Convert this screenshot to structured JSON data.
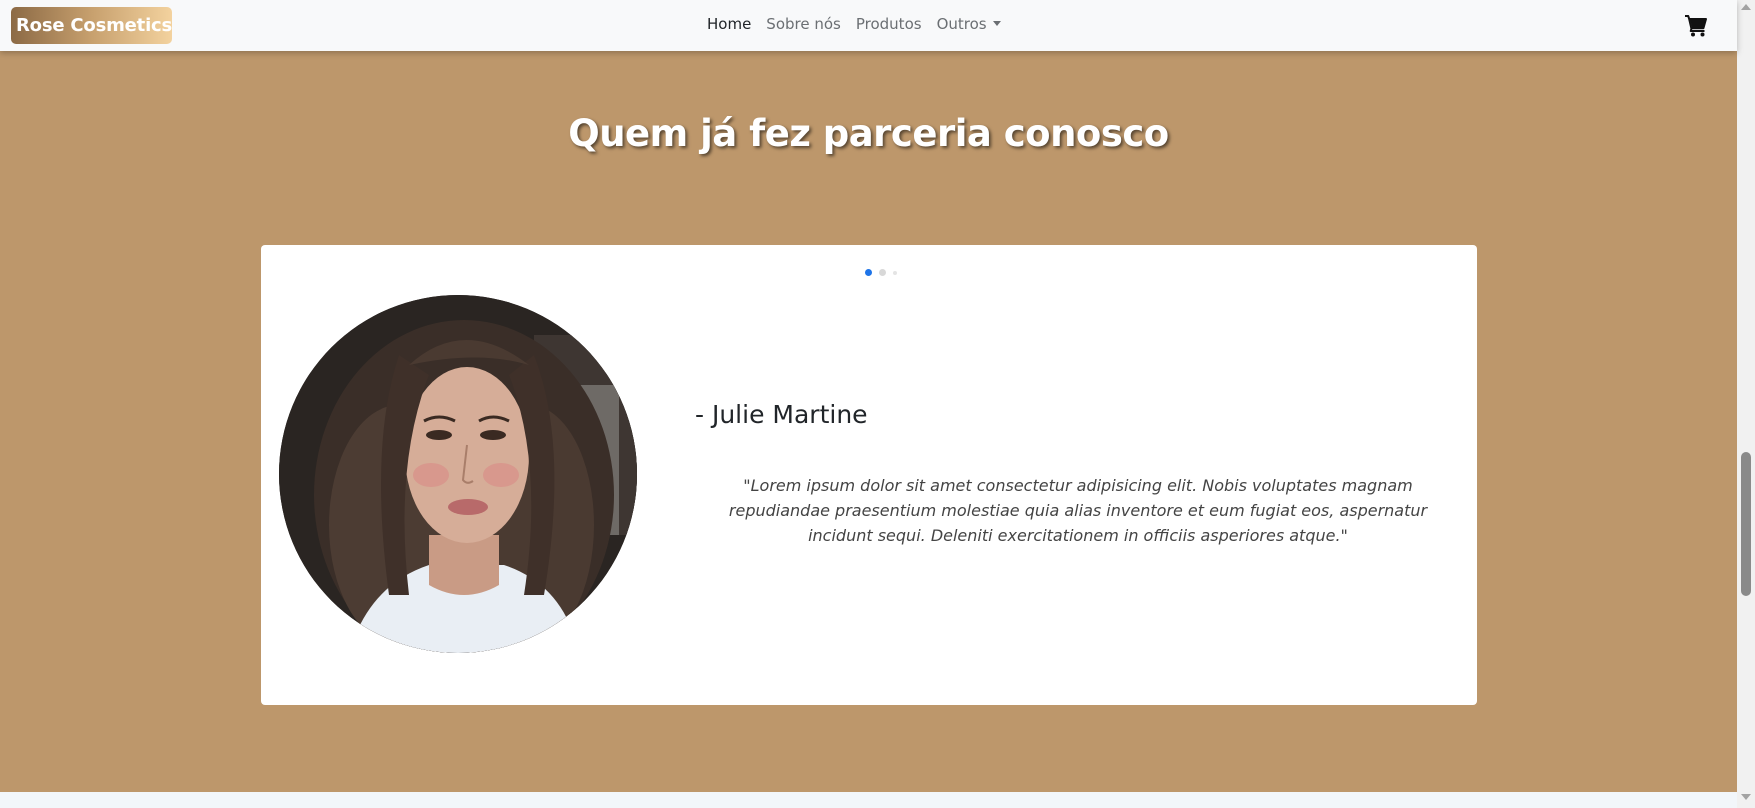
{
  "navbar": {
    "brand": "Rose Cosmetics",
    "links": [
      {
        "label": "Home"
      },
      {
        "label": "Sobre nós"
      },
      {
        "label": "Produtos"
      },
      {
        "label": "Outros"
      }
    ],
    "cart_icon": "shopping-cart-icon"
  },
  "section": {
    "title": "Quem já fez parceria conosco"
  },
  "testimonial": {
    "active_slide": 1,
    "slide_count": 3,
    "name": "- Julie Martine",
    "quote": "\"Lorem ipsum dolor sit amet consectetur adipisicing elit. Nobis voluptates magnam repudiandae praesentium molestiae quia alias inventore et eum fugiat eos, aspernatur incidunt sequi. Deleniti exercitationem in officiis asperiores atque.\""
  },
  "colors": {
    "section_bg": "#bd976b",
    "indicator_active": "#1e74e8",
    "navbar_bg": "#f8f9fa"
  }
}
